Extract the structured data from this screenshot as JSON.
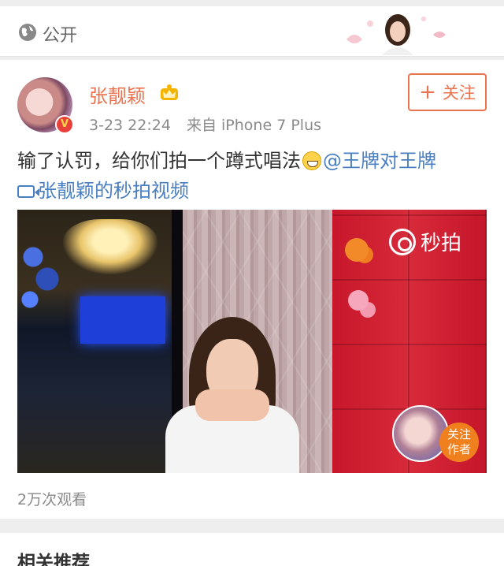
{
  "header": {
    "scope_label": "公开",
    "scope_icon": "globe-icon"
  },
  "post": {
    "author_name": "张靓颖",
    "badge_letter": "V",
    "timestamp": "3-23 22:24",
    "source_prefix": "来自",
    "source_device": "iPhone 7 Plus",
    "follow_label": "关注",
    "text": "输了认罚，给你们拍一个蹲式唱法",
    "mention": "@王牌对王牌",
    "video_link": "张靓颖的秒拍视频",
    "views": "2万次观看"
  },
  "video": {
    "logo_text": "秒拍",
    "author_follow_line1": "关注",
    "author_follow_line2": "作者"
  },
  "related": {
    "title": "相关推荐"
  },
  "colors": {
    "accent_orange": "#eb7350",
    "link_blue": "#4a7fc1",
    "meta_gray": "#8a8a8a"
  }
}
